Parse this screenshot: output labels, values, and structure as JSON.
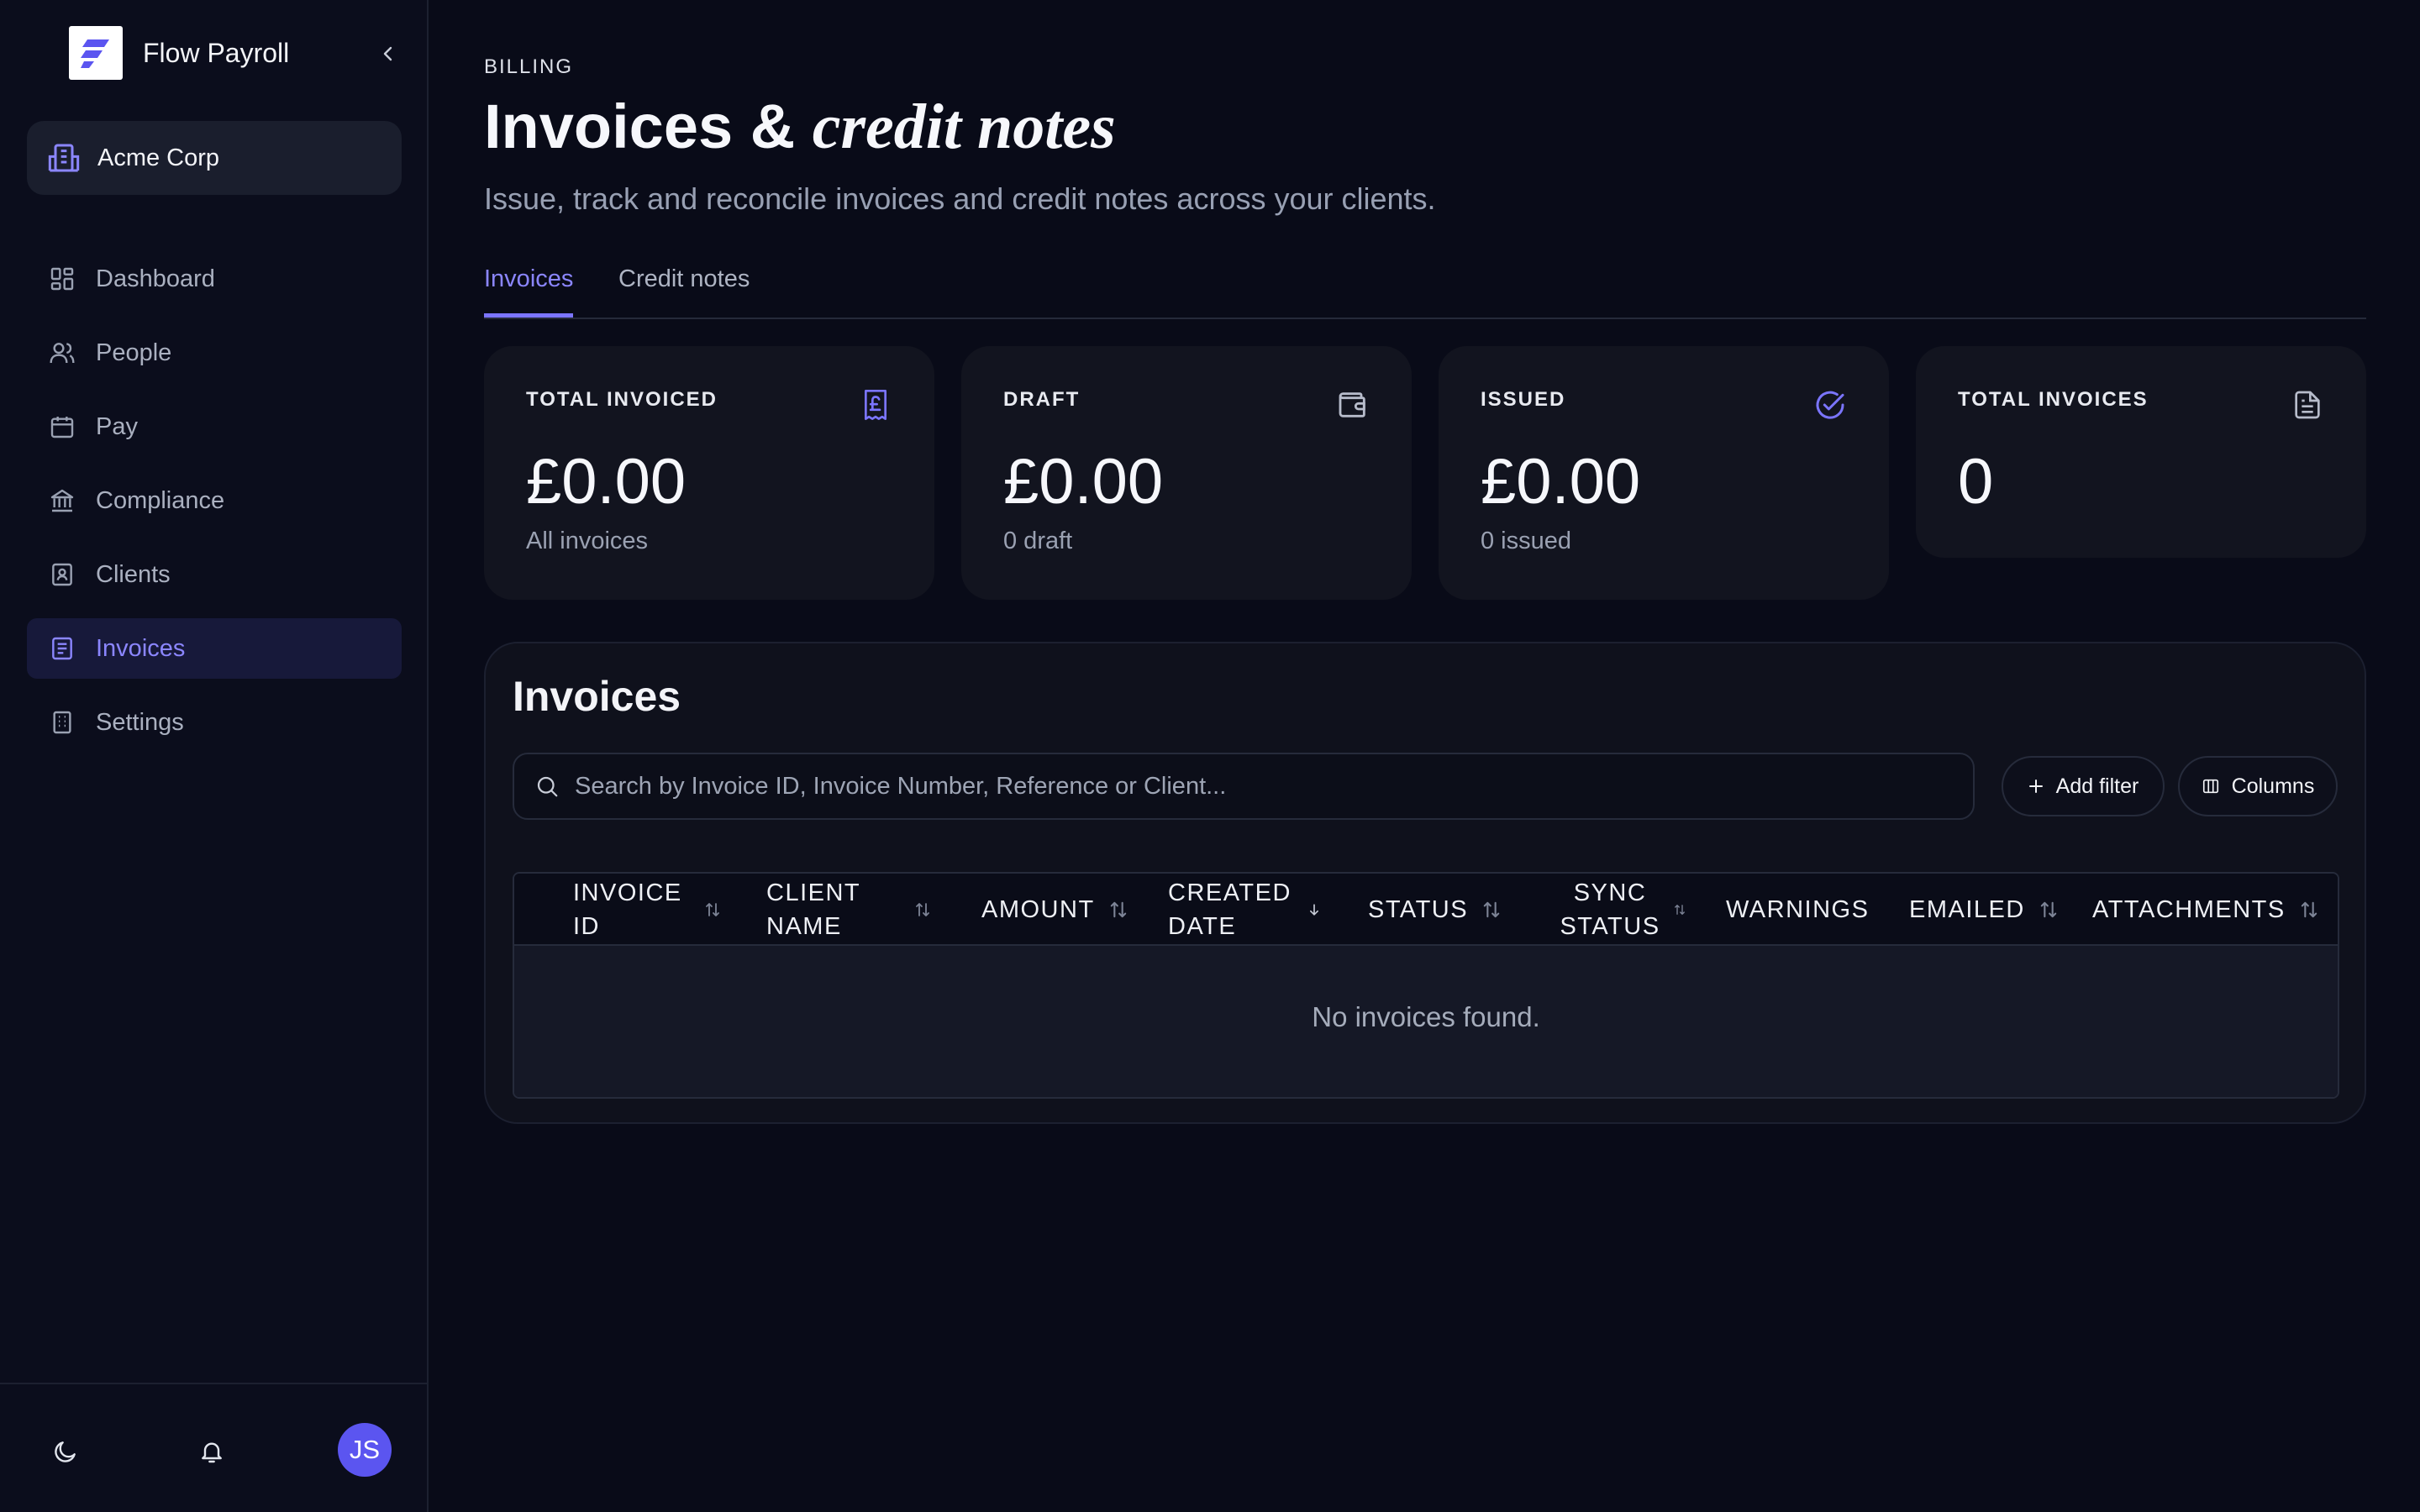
{
  "app": {
    "name": "Flow Payroll"
  },
  "org": {
    "name": "Acme Corp"
  },
  "nav": [
    {
      "label": "Dashboard",
      "icon": "dashboard-icon"
    },
    {
      "label": "People",
      "icon": "people-icon"
    },
    {
      "label": "Pay",
      "icon": "calendar-icon"
    },
    {
      "label": "Compliance",
      "icon": "bank-icon"
    },
    {
      "label": "Clients",
      "icon": "contact-book-icon"
    },
    {
      "label": "Invoices",
      "icon": "invoice-icon",
      "active": true
    },
    {
      "label": "Settings",
      "icon": "building-icon"
    }
  ],
  "user": {
    "initials": "JS"
  },
  "header": {
    "eyebrow": "BILLING",
    "title_main": "Invoices &",
    "title_accent": "credit notes",
    "subtitle": "Issue, track and reconcile invoices and credit notes across your clients."
  },
  "tabs": [
    {
      "label": "Invoices",
      "active": true
    },
    {
      "label": "Credit notes",
      "active": false
    }
  ],
  "stats": [
    {
      "label": "TOTAL INVOICED",
      "value": "£0.00",
      "sub": "All invoices",
      "icon": "pound-receipt-icon"
    },
    {
      "label": "DRAFT",
      "value": "£0.00",
      "sub": "0 draft",
      "icon": "wallet-icon"
    },
    {
      "label": "ISSUED",
      "value": "£0.00",
      "sub": "0 issued",
      "icon": "check-circle-icon"
    },
    {
      "label": "TOTAL INVOICES",
      "value": "0",
      "sub": "",
      "icon": "document-icon"
    }
  ],
  "invoices_panel": {
    "title": "Invoices",
    "search_placeholder": "Search by Invoice ID, Invoice Number, Reference or Client...",
    "add_filter_label": "Add filter",
    "columns_label": "Columns",
    "columns": [
      {
        "label": "INVOICE ID",
        "sort": "both"
      },
      {
        "label": "CLIENT NAME",
        "sort": "both"
      },
      {
        "label": "AMOUNT",
        "sort": "both"
      },
      {
        "label": "CREATED DATE",
        "sort": "desc"
      },
      {
        "label": "STATUS",
        "sort": "both"
      },
      {
        "label": "SYNC STATUS",
        "sort": "both"
      },
      {
        "label": "WARNINGS",
        "sort": "none"
      },
      {
        "label": "EMAILED",
        "sort": "both"
      },
      {
        "label": "ATTACHMENTS",
        "sort": "both"
      }
    ],
    "rows": [],
    "empty_text": "No invoices found."
  },
  "colors": {
    "accent": "#7b75ff",
    "background": "#090b18",
    "card": "#12141f",
    "avatar": "#5b55f0"
  }
}
